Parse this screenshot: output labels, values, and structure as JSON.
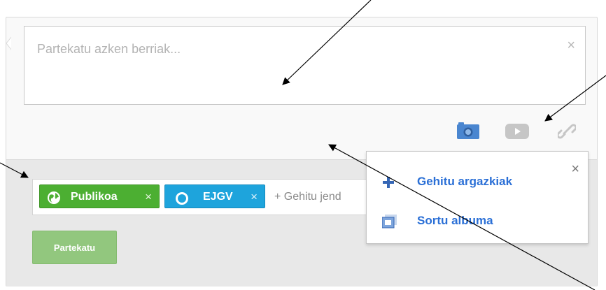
{
  "composer": {
    "placeholder": "Partekatu azken berriak...",
    "close_symbol": "×"
  },
  "toolbar": {
    "icons": [
      "camera-icon",
      "video-icon",
      "link-icon"
    ],
    "active_color": "#4a86d0",
    "inactive_color": "#c6c6c6"
  },
  "share": {
    "chips": [
      {
        "label": "Publikoa",
        "remove": "×",
        "icon": "globe-icon",
        "color": "#4caf32"
      },
      {
        "label": "EJGV",
        "remove": "×",
        "icon": "circle-icon",
        "color": "#1ea4dc"
      }
    ],
    "add_people": "+ Gehitu jend",
    "share_button": "Partekatu",
    "share_button_color": "#92c77e"
  },
  "photo_menu": {
    "close_symbol": "×",
    "items": [
      {
        "label": "Gehitu argazkiak",
        "icon": "plus-icon"
      },
      {
        "label": "Sortu albuma",
        "icon": "album-icon"
      }
    ],
    "link_color": "#2a6fd6"
  }
}
